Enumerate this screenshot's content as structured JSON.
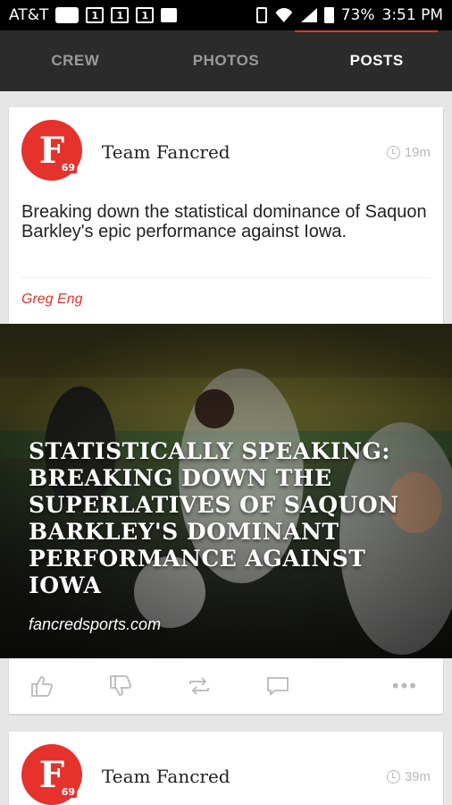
{
  "status_bar": {
    "carrier": "AT&T",
    "battery": "73%",
    "time": "3:51 PM"
  },
  "tabs": [
    {
      "label": "CREW",
      "active": false
    },
    {
      "label": "PHOTOS",
      "active": false
    },
    {
      "label": "POSTS",
      "active": true
    }
  ],
  "posts": [
    {
      "avatar_letter": "F",
      "avatar_badge": "69",
      "author": "Team Fancred",
      "time": "19m",
      "text": "Breaking down the statistical dominance of Saquon Barkley's epic performance against Iowa.",
      "byline": "Greg Eng",
      "media": {
        "headline": "Statistically Speaking: Breaking Down The Superlatives Of Saquon Barkley's Dominant Performance Against Iowa",
        "source": "fancredsports.com"
      },
      "actions": [
        "like-icon",
        "dislike-icon",
        "repost-icon",
        "comment-icon",
        "more-icon"
      ],
      "more_label": "•••"
    },
    {
      "avatar_letter": "F",
      "avatar_badge": "69",
      "author": "Team Fancred",
      "time": "39m"
    }
  ],
  "colors": {
    "accent": "#e5322d",
    "tab_bar": "#2b2b2b",
    "background": "#e6e6e6"
  }
}
